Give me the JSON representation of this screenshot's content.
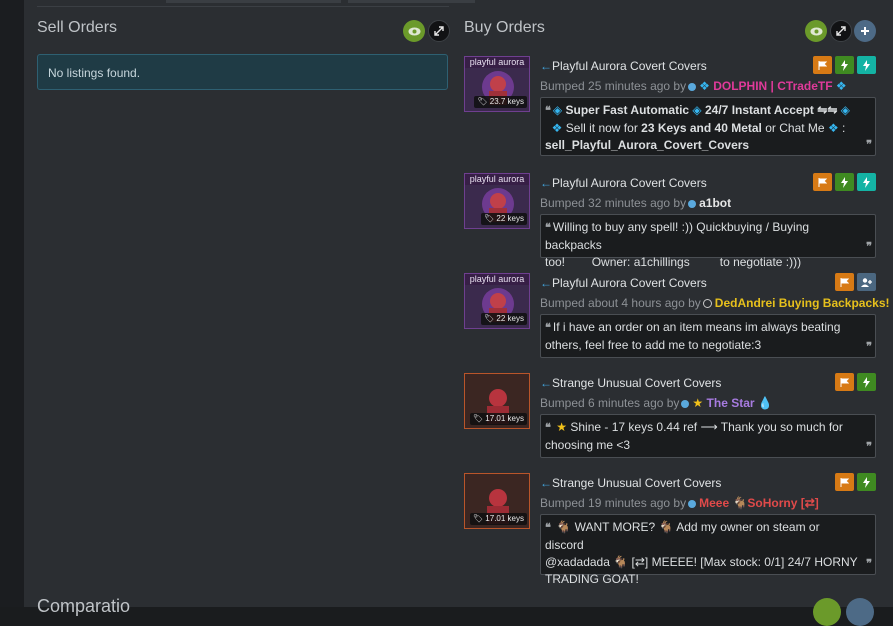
{
  "sell_orders": {
    "title": "Sell Orders",
    "empty_message": "No listings found."
  },
  "buy_orders": {
    "title": "Buy Orders",
    "listings": [
      {
        "item_name": "Playful Aurora Covert Covers",
        "thumb_label": "playful aurora",
        "price_tag": "23.7 keys",
        "bumped": "Bumped 25 minutes ago by",
        "user_name": "DOLPHIN | CTradeTF",
        "user_color": "#e03a9a",
        "badges": [
          "flag",
          "bolt",
          "bolt-teal"
        ],
        "comment_parts": [
          "Super Fast Automatic",
          "24/7 Instant Accept ⇋⇋",
          "Sell it now for",
          "23 Keys and 40 Metal",
          "or Chat Me",
          "sell_Playful_Aurora_Covert_Covers"
        ]
      },
      {
        "item_name": "Playful Aurora Covert Covers",
        "thumb_label": "playful aurora",
        "price_tag": "22 keys",
        "bumped": "Bumped 32 minutes ago by",
        "user_name": "a1bot",
        "user_color": "#e6e6e6",
        "badges": [
          "flag",
          "bolt",
          "bolt-teal"
        ],
        "comment_line1": "Willing to buy any spell! :)) Quickbuying / Buying backpacks",
        "comment_line2": "too!        Owner: a1chillings         to negotiate :)))"
      },
      {
        "item_name": "Playful Aurora Covert Covers",
        "thumb_label": "playful aurora",
        "price_tag": "22 keys",
        "bumped": "Bumped about 4 hours ago by",
        "user_name": "DedAndrei Buying Backpacks!",
        "user_color": "#e6c01c",
        "badges": [
          "flag",
          "add-friend"
        ],
        "comment_line1": "If i have an order on an item means im always beating",
        "comment_line2": "others, feel free to add me to negotiate:3"
      },
      {
        "item_name": "Strange Unusual Covert Covers",
        "price_tag": "17.01 keys",
        "bumped": "Bumped 6 minutes ago by",
        "user_name": "The Star",
        "user_color": "#a77be0",
        "badges": [
          "flag",
          "bolt"
        ],
        "comment_line1": "Shine - 17 keys 0.44 ref ⟶ Thank you so much for",
        "comment_line2": "choosing me <3"
      },
      {
        "item_name": "Strange Unusual Covert Covers",
        "price_tag": "17.01 keys",
        "bumped": "Bumped 19 minutes ago by",
        "user_name_a": "Meee",
        "user_name_b": "SoHorny [⇄]",
        "user_color": "#e04a4a",
        "badges": [
          "flag",
          "bolt"
        ],
        "comment_line1": "WANT MORE?",
        "comment_line1b": "Add my owner on steam or discord",
        "comment_line2": "@xadadada",
        "comment_line2b": "[⇄] MEEEE! [Max stock: 0/1] 24/7 HORNY",
        "comment_line3": "TRADING GOAT!"
      }
    ]
  },
  "next_section_title": "Comparatio",
  "colors": {
    "panel": "#2b2e32",
    "info": "#1f3b45",
    "accent_blue": "#41a6e0",
    "badge_flag": "#d77a15",
    "badge_bolt": "#3f8a21",
    "badge_teal": "#14b3a4",
    "eye_green": "#6b9a2a"
  },
  "icons": [
    "eye-icon",
    "expand-icon",
    "plus-icon",
    "flag-icon",
    "bolt-icon",
    "add-friend-icon",
    "tag-icon",
    "quote-icon",
    "arrow-left-icon"
  ]
}
